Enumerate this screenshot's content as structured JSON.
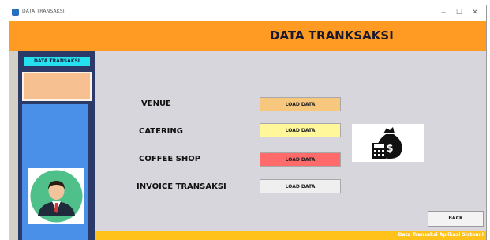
{
  "window": {
    "title": "DATA TRANSAKSI",
    "controls": {
      "minimize": "–",
      "maximize": "☐",
      "close": "✕"
    }
  },
  "header": {
    "title": "DATA TRANKSAKSI"
  },
  "sidebar": {
    "title": "DATA TRANSAKSI",
    "avatar_icon": "user-avatar-icon"
  },
  "rows": [
    {
      "label": "VENUE",
      "button": "LOAD DATA",
      "color": "#f7c77e"
    },
    {
      "label": "CATERING",
      "button": "LOAD DATA",
      "color": "#fff79a"
    },
    {
      "label": "COFFEE SHOP",
      "button": "LOAD DATA",
      "color": "#ff6a6a"
    },
    {
      "label": "INVOICE TRANSAKSI",
      "button": "LOAD DATA",
      "color": "#efefef"
    }
  ],
  "icons": {
    "money": "money-bag-calculator-icon"
  },
  "back_button": "BACK",
  "footer": {
    "text": "Data Transaksi Aplikasi Sistem I"
  },
  "colors": {
    "header": "#ff9a22",
    "sidebar": "#2b3a66",
    "sidebar_title": "#25e0ee",
    "sidebar_blue": "#4a90e8",
    "footer": "#ffc21a"
  }
}
